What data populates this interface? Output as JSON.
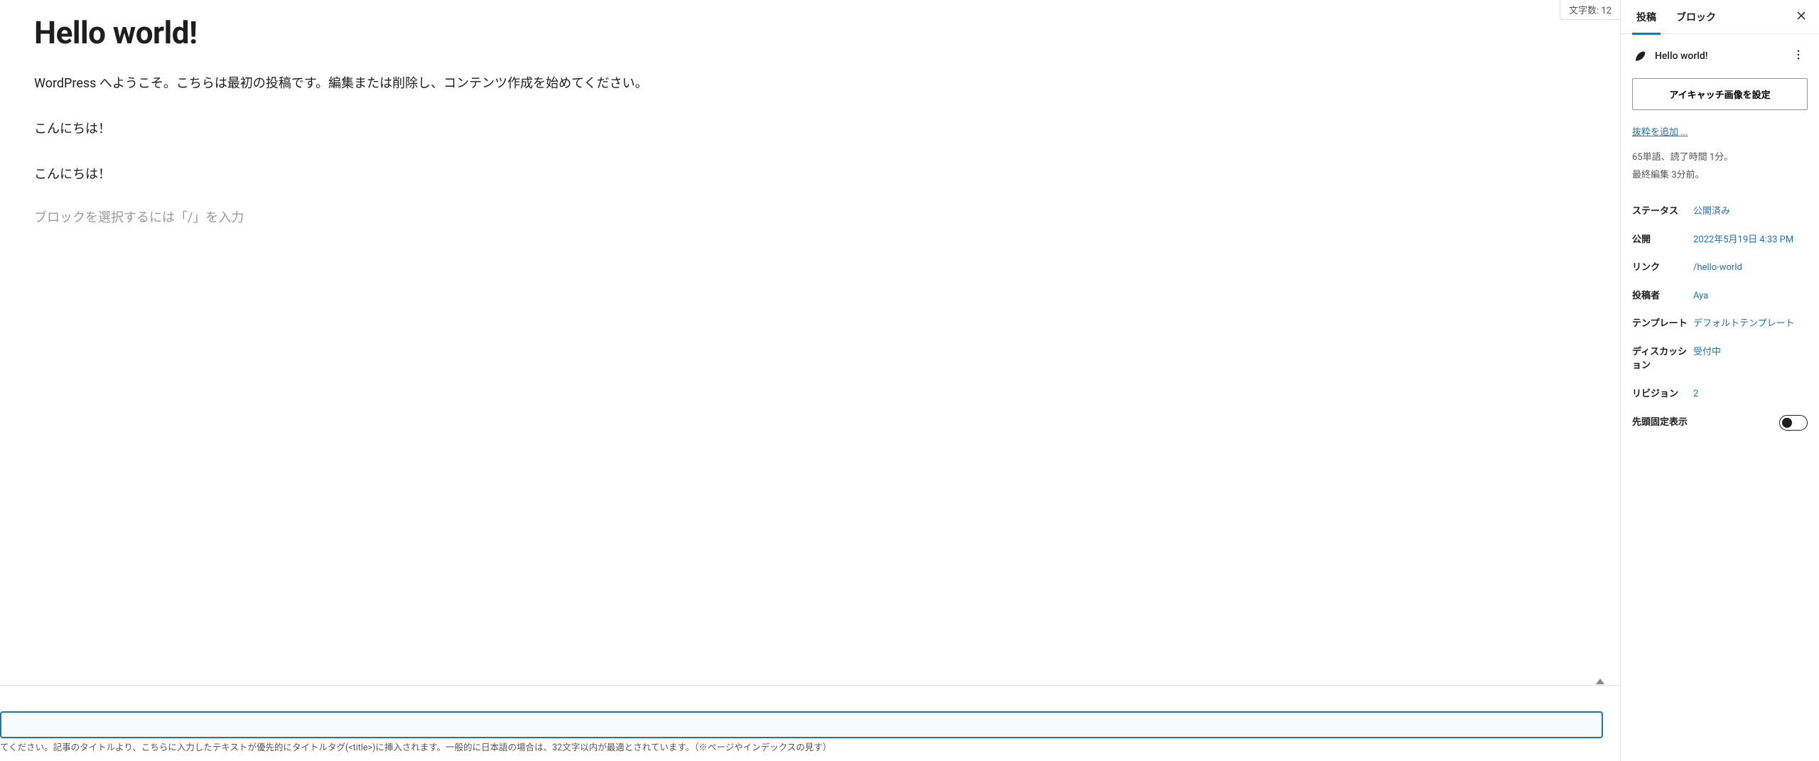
{
  "editor": {
    "char_count_label": "文字数: 12",
    "title": "Hello world!",
    "paragraphs": [
      "WordPress へようこそ。こちらは最初の投稿です。編集または削除し、コンテンツ作成を始めてください。",
      "こんにちは！",
      "こんにちは！"
    ],
    "block_placeholder": "ブロックを選択するには「/」を入力",
    "help_text": "てください。記事のタイトルより、こちらに入力したテキストが優先的にタイトルタグ(<title>)に挿入されます。一般的に日本語の場合は、32文字以内が最適とされています。（※ページやインデックスの見す）"
  },
  "sidebar": {
    "tabs": {
      "post": "投稿",
      "block": "ブロック"
    },
    "post_name": "Hello world!",
    "set_featured_image": "アイキャッチ画像を設定",
    "add_excerpt": "抜粋を追加 ...",
    "word_count": "65単語、読了時間 1分。",
    "last_edit": "最終編集 3分前。",
    "rows": {
      "status": {
        "label": "ステータス",
        "value": "公開済み"
      },
      "publish": {
        "label": "公開",
        "value": "2022年5月19日 4:33 PM"
      },
      "link": {
        "label": "リンク",
        "value": "/hello-world"
      },
      "author": {
        "label": "投稿者",
        "value": "Aya"
      },
      "template": {
        "label": "テンプレート",
        "value": "デフォルトテンプレート"
      },
      "discussion": {
        "label": "ディスカッション",
        "value": "受付中"
      },
      "revisions": {
        "label": "リビジョン",
        "value": "2"
      },
      "sticky": {
        "label": "先頭固定表示"
      }
    }
  }
}
